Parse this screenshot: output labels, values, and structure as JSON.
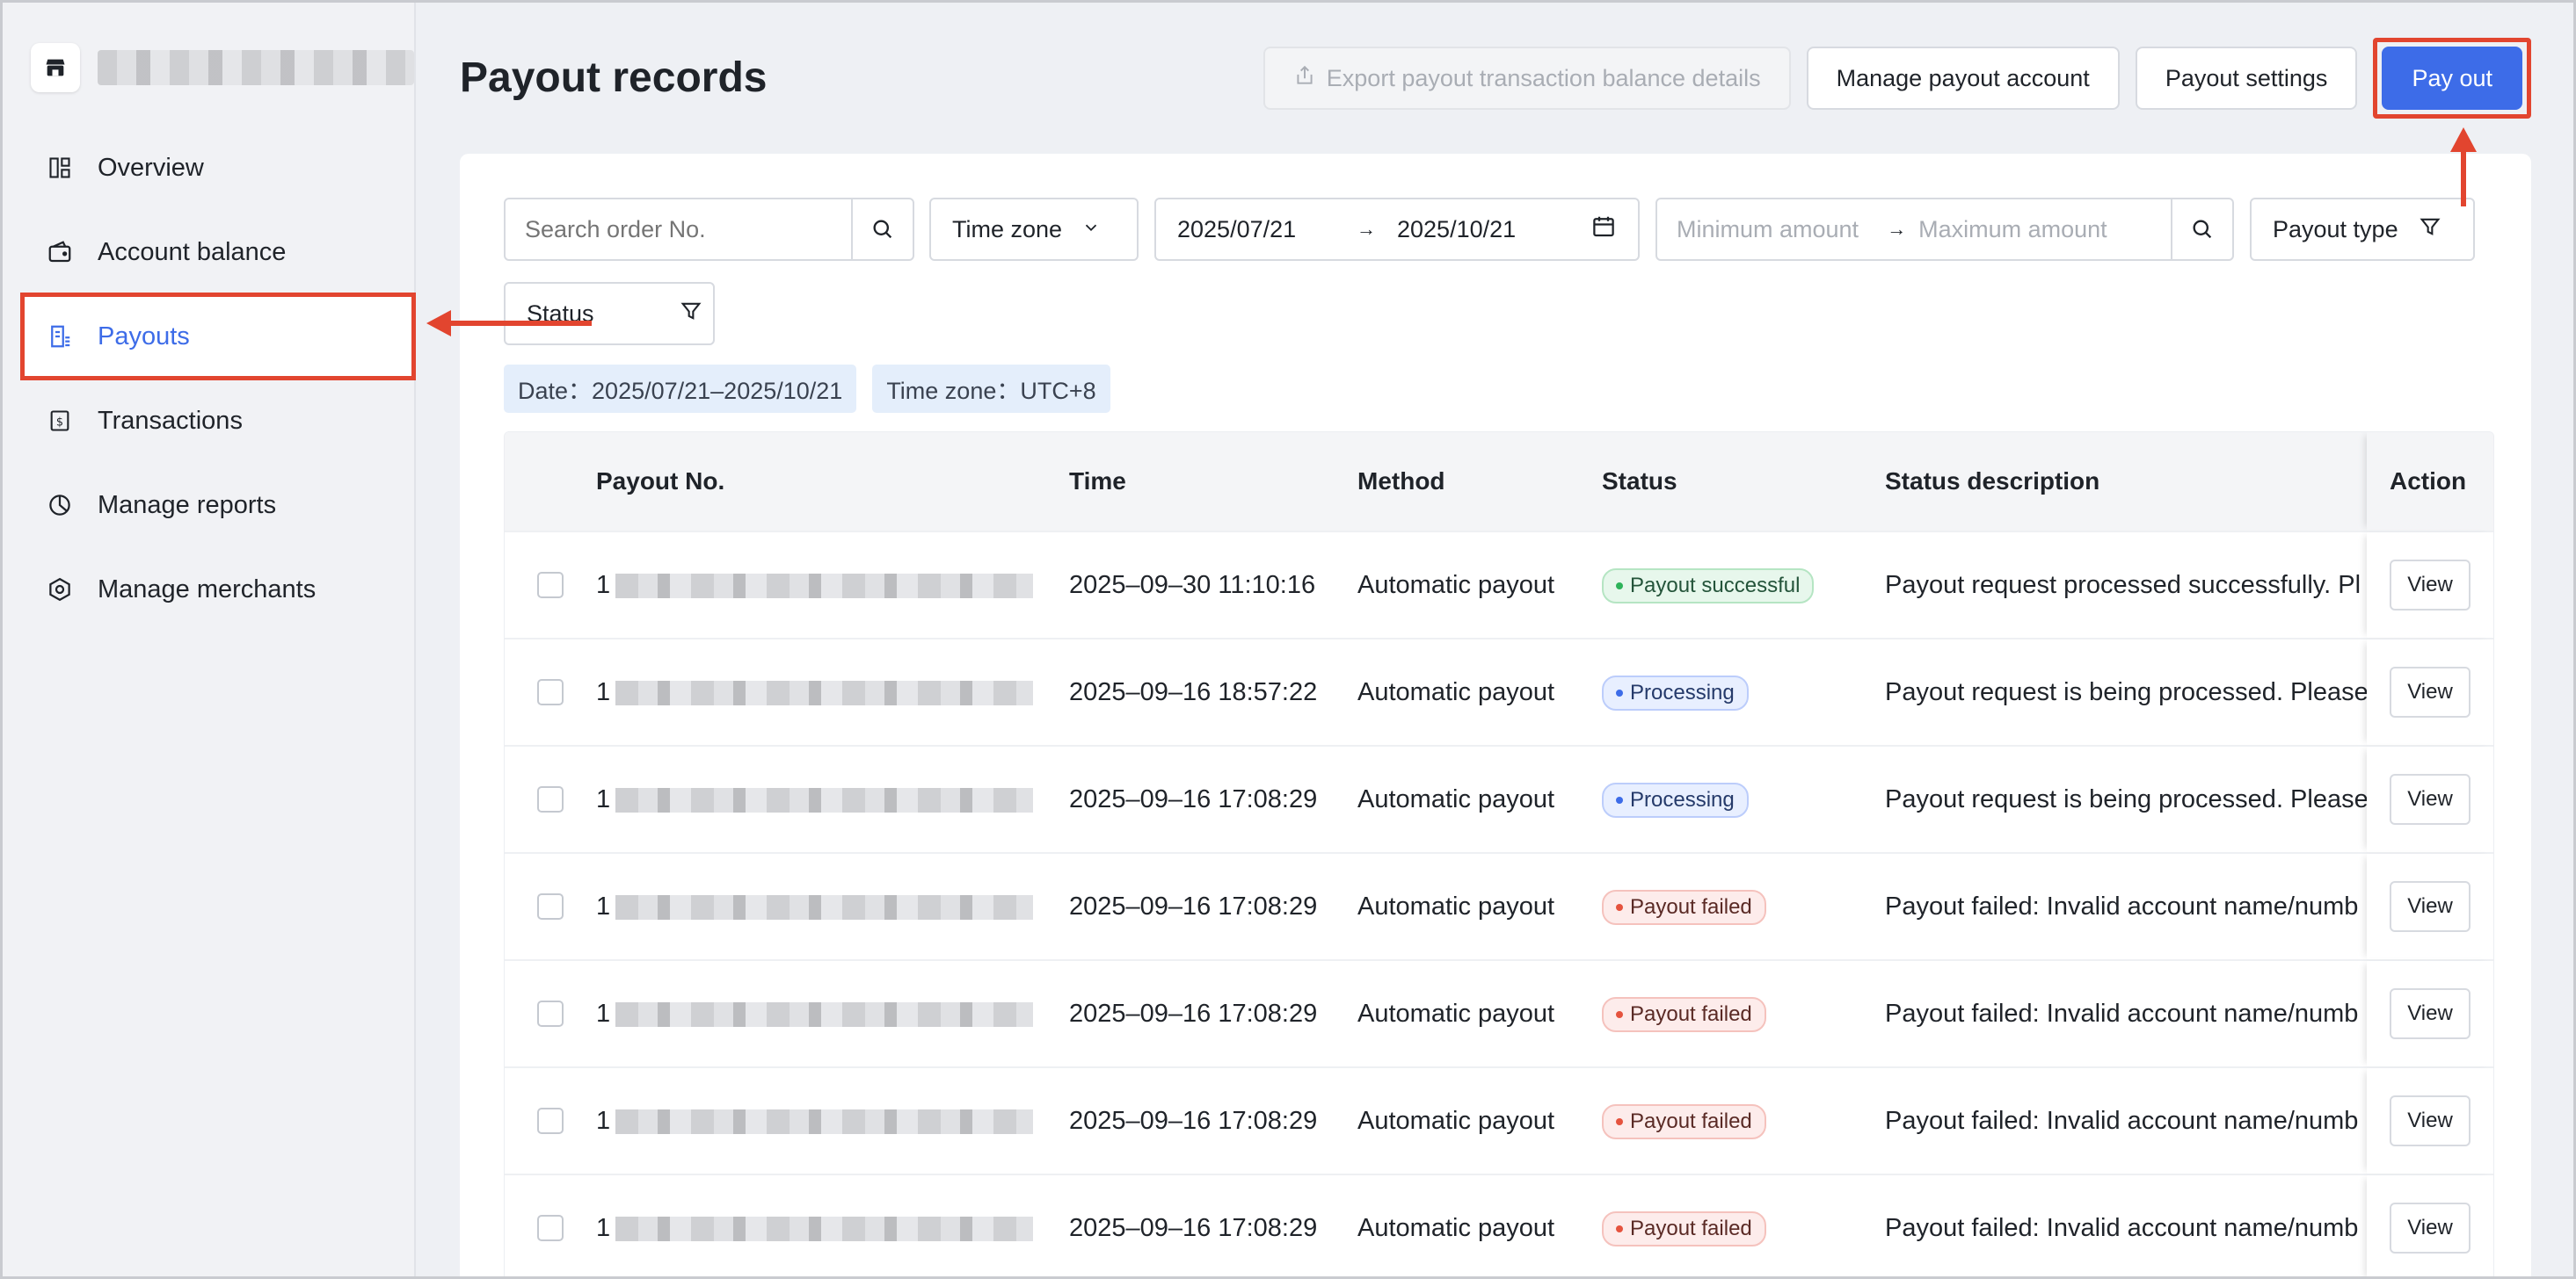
{
  "sidebar": {
    "items": [
      {
        "label": "Overview",
        "icon": "overview-icon"
      },
      {
        "label": "Account balance",
        "icon": "wallet-icon"
      },
      {
        "label": "Payouts",
        "icon": "payout-doc-icon",
        "active": true
      },
      {
        "label": "Transactions",
        "icon": "dollar-receipt-icon"
      },
      {
        "label": "Manage reports",
        "icon": "pie-chart-icon"
      },
      {
        "label": "Manage merchants",
        "icon": "hexagon-icon"
      }
    ]
  },
  "header": {
    "title": "Payout records",
    "export_label": "Export payout transaction balance details",
    "manage_account_label": "Manage payout account",
    "settings_label": "Payout settings",
    "pay_out_label": "Pay out"
  },
  "filters": {
    "search_placeholder": "Search order No.",
    "time_zone_label": "Time zone",
    "date_start": "2025/07/21",
    "date_end": "2025/10/21",
    "min_amount_placeholder": "Minimum amount",
    "max_amount_placeholder": "Maximum amount",
    "payout_type_label": "Payout type",
    "status_label": "Status",
    "range_separator": "→"
  },
  "tags": {
    "date": "Date：2025/07/21–2025/10/21",
    "time_zone": "Time zone：UTC+8"
  },
  "table": {
    "columns": [
      "Payout No.",
      "Time",
      "Method",
      "Status",
      "Status description",
      "Action"
    ],
    "rows": [
      {
        "no_prefix": "1",
        "time": "2025–09–30 11:10:16",
        "method": "Automatic payout",
        "status": "Payout successful",
        "status_kind": "success",
        "desc": "Payout request processed successfully. Pl",
        "action": "View"
      },
      {
        "no_prefix": "1",
        "time": "2025–09–16 18:57:22",
        "method": "Automatic payout",
        "status": "Processing",
        "status_kind": "processing",
        "desc": "Payout request is being processed. Please",
        "action": "View"
      },
      {
        "no_prefix": "1",
        "time": "2025–09–16 17:08:29",
        "method": "Automatic payout",
        "status": "Processing",
        "status_kind": "processing",
        "desc": "Payout request is being processed. Please",
        "action": "View"
      },
      {
        "no_prefix": "1",
        "time": "2025–09–16 17:08:29",
        "method": "Automatic payout",
        "status": "Payout failed",
        "status_kind": "failed",
        "desc": "Payout failed: Invalid account name/numb",
        "action": "View"
      },
      {
        "no_prefix": "1",
        "time": "2025–09–16 17:08:29",
        "method": "Automatic payout",
        "status": "Payout failed",
        "status_kind": "failed",
        "desc": "Payout failed: Invalid account name/numb",
        "action": "View"
      },
      {
        "no_prefix": "1",
        "time": "2025–09–16 17:08:29",
        "method": "Automatic payout",
        "status": "Payout failed",
        "status_kind": "failed",
        "desc": "Payout failed: Invalid account name/numb",
        "action": "View"
      },
      {
        "no_prefix": "1",
        "time": "2025–09–16 17:08:29",
        "method": "Automatic payout",
        "status": "Payout failed",
        "status_kind": "failed",
        "desc": "Payout failed: Invalid account name/numb",
        "action": "View"
      }
    ]
  },
  "colors": {
    "accent": "#3d6ce8",
    "annotation": "#e2452f",
    "success": "#2eb35a",
    "failed": "#e5533e"
  }
}
